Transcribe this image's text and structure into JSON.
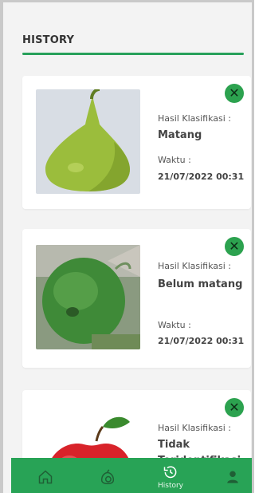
{
  "header": {
    "title": "HISTORY"
  },
  "cards": [
    {
      "label": "Hasil Klasifikasi :",
      "result": "Matang",
      "time_label": "Waktu :",
      "time": "21/07/2022 00:31"
    },
    {
      "label": "Hasil Klasifikasi :",
      "result": "Belum matang",
      "time_label": "Waktu :",
      "time": "21/07/2022 00:31"
    },
    {
      "label": "Hasil Klasifikasi :",
      "result": "Tidak Teridentifikasi",
      "time_label": "",
      "time": ""
    }
  ],
  "nav": {
    "items": [
      {
        "icon": "home-icon",
        "label": ""
      },
      {
        "icon": "scan-icon",
        "label": ""
      },
      {
        "icon": "history-icon",
        "label": "History"
      },
      {
        "icon": "profile-icon",
        "label": ""
      }
    ]
  },
  "colors": {
    "accent": "#28a356",
    "delete": "#2ca24f"
  }
}
